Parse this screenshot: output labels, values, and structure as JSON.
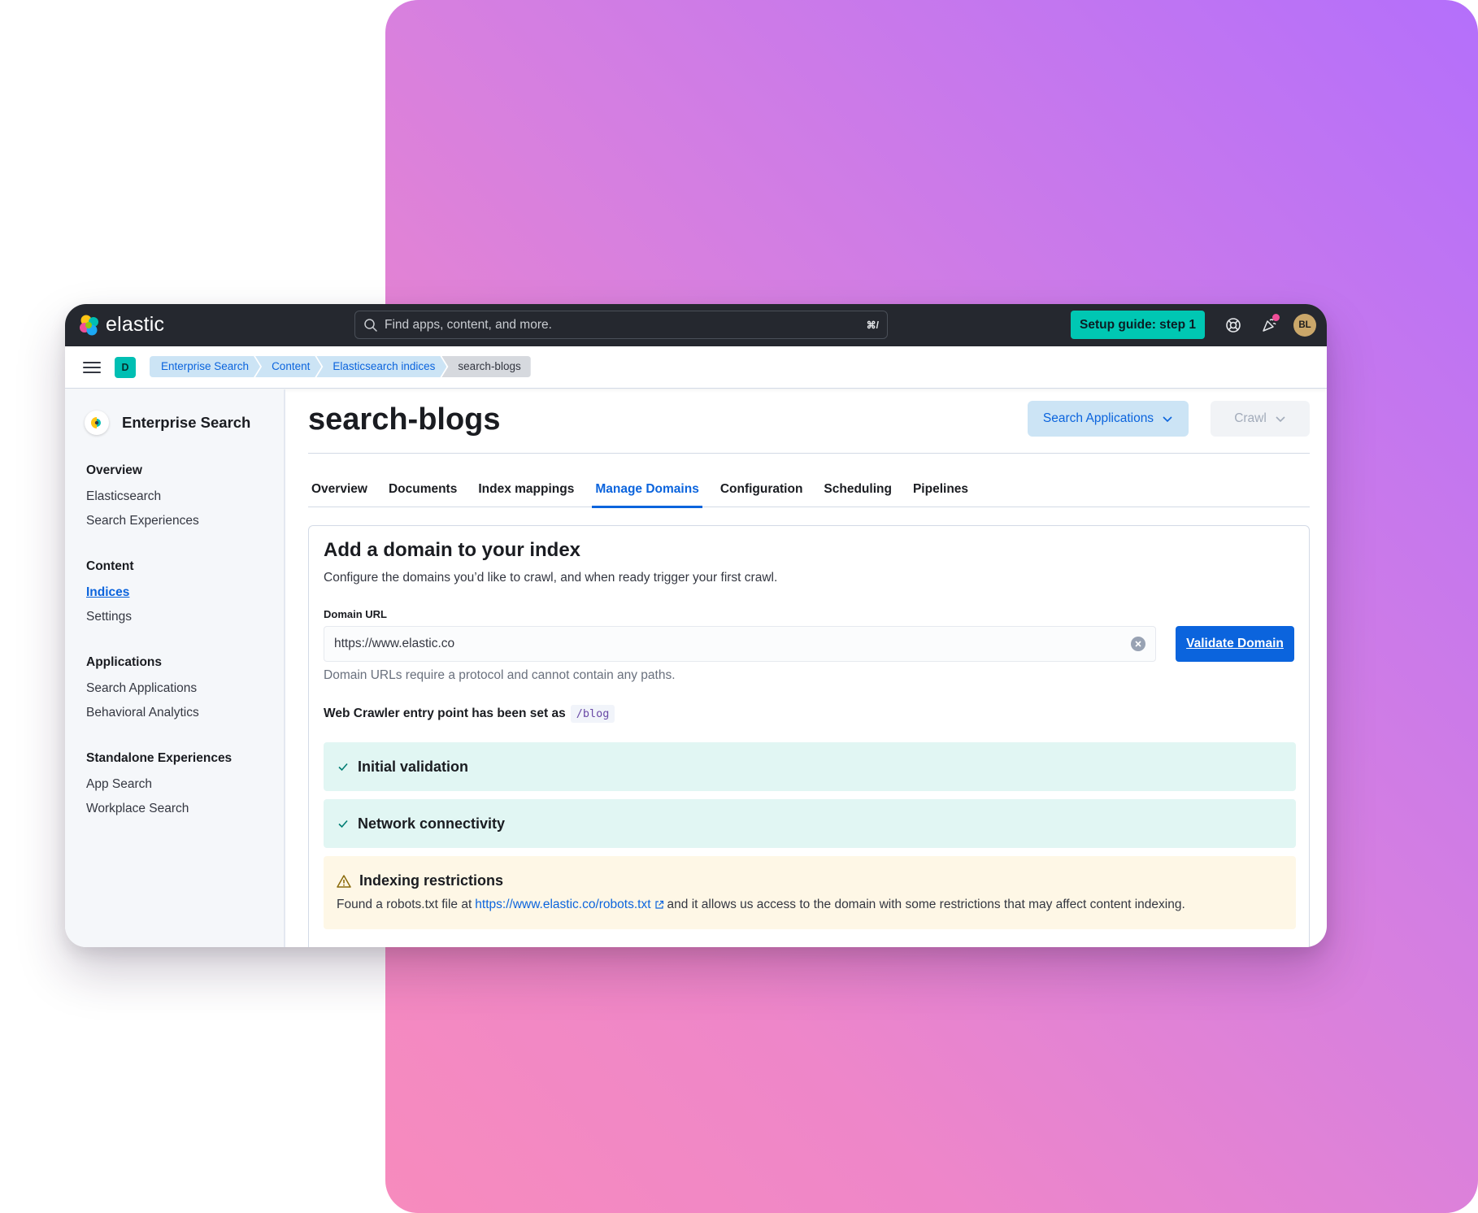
{
  "topbar": {
    "logo_text": "elastic",
    "search_placeholder": "Find apps, content, and more.",
    "search_shortcut": "⌘/",
    "setup_button": "Setup guide: step 1",
    "avatar_initials": "BL"
  },
  "breadcrumbs": {
    "space_badge": "D",
    "items": [
      "Enterprise Search",
      "Content",
      "Elasticsearch indices",
      "search-blogs"
    ]
  },
  "sidebar": {
    "title": "Enterprise Search",
    "groups": [
      {
        "title": "Overview",
        "items": [
          "Elasticsearch",
          "Search Experiences"
        ]
      },
      {
        "title": "Content",
        "items": [
          "Indices",
          "Settings"
        ]
      },
      {
        "title": "Applications",
        "items": [
          "Search Applications",
          "Behavioral Analytics"
        ]
      },
      {
        "title": "Standalone Experiences",
        "items": [
          "App Search",
          "Workplace Search"
        ]
      }
    ]
  },
  "main": {
    "title": "search-blogs",
    "search_apps_button": "Search Applications",
    "crawl_button": "Crawl",
    "tabs": [
      "Overview",
      "Documents",
      "Index mappings",
      "Manage Domains",
      "Configuration",
      "Scheduling",
      "Pipelines"
    ],
    "active_tab": "Manage Domains"
  },
  "panel": {
    "heading": "Add a domain to your index",
    "description": "Configure the domains you’d like to crawl, and when ready trigger your first crawl.",
    "field_label": "Domain URL",
    "field_value": "https://www.elastic.co",
    "validate_button": "Validate Domain",
    "help_text": "Domain URLs require a protocol and cannot contain any paths.",
    "entry_text": "Web Crawler entry point has been set as",
    "entry_path": "/blog",
    "checks": [
      {
        "title": "Initial validation",
        "status": "ok"
      },
      {
        "title": "Network connectivity",
        "status": "ok"
      }
    ],
    "warning": {
      "title": "Indexing restrictions",
      "before": "Found a robots.txt file at",
      "link": "https://www.elastic.co/robots.txt",
      "after": "and it allows us access to the domain with some restrictions that may affect content indexing."
    }
  },
  "colors": {
    "accent": "#0b64dd",
    "setup": "#00c7b3",
    "success_bg": "#e1f6f3",
    "warning_bg": "#fef7e6"
  }
}
